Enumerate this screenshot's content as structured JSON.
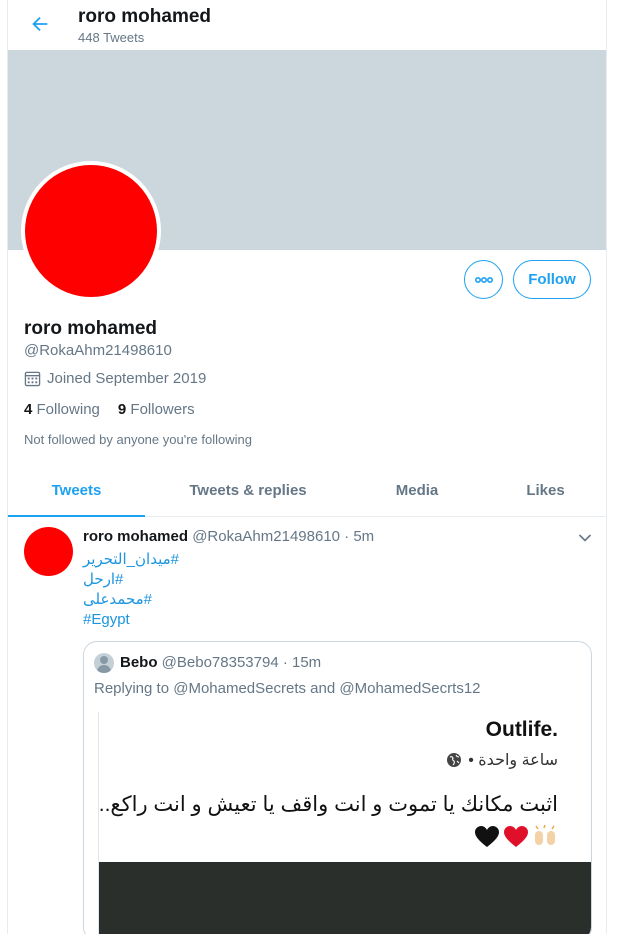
{
  "header": {
    "title": "roro mohamed",
    "subtitle": "448 Tweets"
  },
  "profile": {
    "name": "roro mohamed",
    "handle": "@RokaAhm21498610",
    "joined": "Joined September 2019",
    "following_count": "4",
    "following_label": "Following",
    "followers_count": "9",
    "followers_label": "Followers",
    "not_followed": "Not followed by anyone you're following",
    "follow_button": "Follow",
    "avatar_color": "#ff0000",
    "banner_color": "#ccd6dd"
  },
  "tabs": [
    {
      "label": "Tweets",
      "active": true
    },
    {
      "label": "Tweets & replies",
      "active": false
    },
    {
      "label": "Media",
      "active": false
    },
    {
      "label": "Likes",
      "active": false
    }
  ],
  "tweet": {
    "name": "roro mohamed",
    "handle_time": "@RokaAhm21498610 · 5m",
    "hashtags": [
      "#ميدان_التحرير",
      "#ارحل",
      "#محمدعلى",
      "#Egypt"
    ],
    "quote": {
      "name": "Bebo",
      "handle_time": "@Bebo78353794 · 15m",
      "reply_prefix": "Replying to",
      "mention1": "@MohamedSecrets",
      "reply_and": "and",
      "mention2": "@MohamedSecrts12",
      "image": {
        "brand": "Outlife.",
        "time": "ساعة واحدة •",
        "text": "اثبت مكانك يا تموت و انت واقف يا تعيش و انت راكع.."
      }
    }
  },
  "colors": {
    "accent": "#1da1f2",
    "link": "#1b95e0",
    "muted": "#657786"
  },
  "icons": {
    "back": "arrow-left-icon",
    "more": "more-dots-icon",
    "calendar": "calendar-icon",
    "caret": "chevron-down-icon",
    "globe": "globe-icon"
  }
}
